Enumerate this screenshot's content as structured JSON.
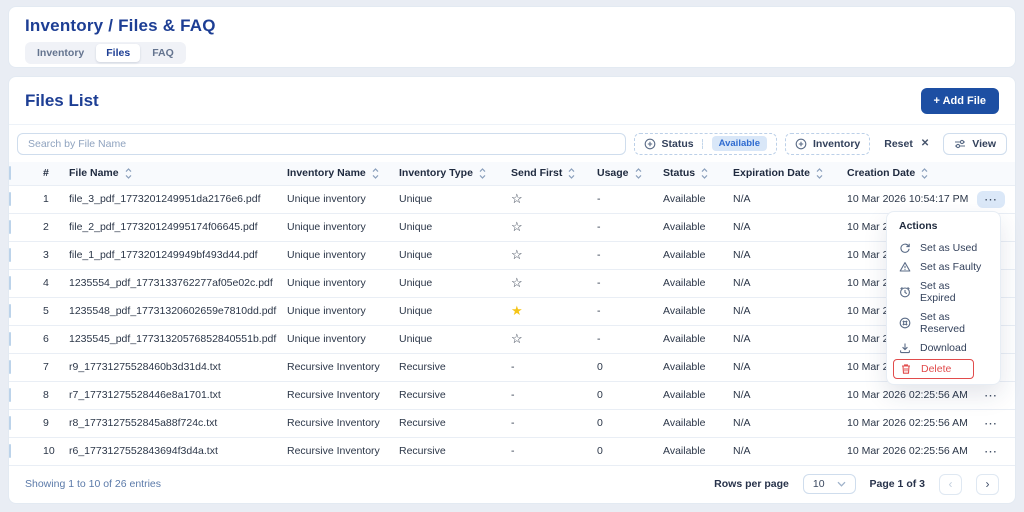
{
  "header": {
    "title": "Inventory / Files & FAQ",
    "tabs": [
      {
        "label": "Inventory",
        "active": false
      },
      {
        "label": "Files",
        "active": true
      },
      {
        "label": "FAQ",
        "active": false
      }
    ]
  },
  "files_panel": {
    "title": "Files List",
    "add_file_label": "+ Add File",
    "search_placeholder": "Search by File Name",
    "filters": {
      "status_label": "Status",
      "status_value": "Available",
      "status_icon": "plus-circle-icon",
      "inventory_label": "Inventory",
      "inventory_icon": "plus-circle-icon",
      "reset_label": "Reset",
      "reset_icon": "close-icon",
      "view_label": "View",
      "view_icon": "sliders-icon"
    },
    "table": {
      "columns": [
        {
          "label": "#",
          "sortable": false
        },
        {
          "label": "File Name",
          "sortable": true
        },
        {
          "label": "Inventory Name",
          "sortable": true
        },
        {
          "label": "Inventory Type",
          "sortable": true
        },
        {
          "label": "Send First",
          "sortable": true
        },
        {
          "label": "Usage",
          "sortable": true
        },
        {
          "label": "Status",
          "sortable": true
        },
        {
          "label": "Expiration Date",
          "sortable": true
        },
        {
          "label": "Creation Date",
          "sortable": true
        }
      ],
      "rows": [
        {
          "num": "1",
          "file_name": "file_3_pdf_1773201249951da2176e6.pdf",
          "inventory_name": "Unique inventory",
          "inventory_type": "Unique",
          "send_first": "star-outline",
          "usage": "-",
          "status": "Available",
          "expiration": "N/A",
          "created": "10 Mar 2026 10:54:17 PM",
          "actions_open": true
        },
        {
          "num": "2",
          "file_name": "file_2_pdf_177320124995174f06645.pdf",
          "inventory_name": "Unique inventory",
          "inventory_type": "Unique",
          "send_first": "star-outline",
          "usage": "-",
          "status": "Available",
          "expiration": "N/A",
          "created": "10 Mar 202",
          "actions_open": false
        },
        {
          "num": "3",
          "file_name": "file_1_pdf_1773201249949bf493d44.pdf",
          "inventory_name": "Unique inventory",
          "inventory_type": "Unique",
          "send_first": "star-outline",
          "usage": "-",
          "status": "Available",
          "expiration": "N/A",
          "created": "10 Mar 202",
          "actions_open": false
        },
        {
          "num": "4",
          "file_name": "1235554_pdf_1773133762277af05e02c.pdf",
          "inventory_name": "Unique inventory",
          "inventory_type": "Unique",
          "send_first": "star-outline",
          "usage": "-",
          "status": "Available",
          "expiration": "N/A",
          "created": "10 Mar 202",
          "actions_open": false
        },
        {
          "num": "5",
          "file_name": "1235548_pdf_17731320602659e7810dd.pdf",
          "inventory_name": "Unique inventory",
          "inventory_type": "Unique",
          "send_first": "star-filled",
          "usage": "-",
          "status": "Available",
          "expiration": "N/A",
          "created": "10 Mar 202",
          "actions_open": false
        },
        {
          "num": "6",
          "file_name": "1235545_pdf_17731320576852840551b.pdf",
          "inventory_name": "Unique inventory",
          "inventory_type": "Unique",
          "send_first": "star-outline",
          "usage": "-",
          "status": "Available",
          "expiration": "N/A",
          "created": "10 Mar 202",
          "actions_open": false
        },
        {
          "num": "7",
          "file_name": "r9_17731275528460b3d31d4.txt",
          "inventory_name": "Recursive Inventory",
          "inventory_type": "Recursive",
          "send_first": "-",
          "usage": "0",
          "status": "Available",
          "expiration": "N/A",
          "created": "10 Mar 2026 02:25:56 AM",
          "actions_open": false
        },
        {
          "num": "8",
          "file_name": "r7_17731275528446e8a1701.txt",
          "inventory_name": "Recursive Inventory",
          "inventory_type": "Recursive",
          "send_first": "-",
          "usage": "0",
          "status": "Available",
          "expiration": "N/A",
          "created": "10 Mar 2026 02:25:56 AM",
          "actions_open": false
        },
        {
          "num": "9",
          "file_name": "r8_1773127552845a88f724c.txt",
          "inventory_name": "Recursive Inventory",
          "inventory_type": "Recursive",
          "send_first": "-",
          "usage": "0",
          "status": "Available",
          "expiration": "N/A",
          "created": "10 Mar 2026 02:25:56 AM",
          "actions_open": false
        },
        {
          "num": "10",
          "file_name": "r6_1773127552843694f3d4a.txt",
          "inventory_name": "Recursive Inventory",
          "inventory_type": "Recursive",
          "send_first": "-",
          "usage": "0",
          "status": "Available",
          "expiration": "N/A",
          "created": "10 Mar 2026 02:25:56 AM",
          "actions_open": false
        }
      ]
    },
    "footer": {
      "showing_text": "Showing 1 to 10 of 26 entries",
      "rows_per_page_label": "Rows per page",
      "rows_per_page_value": "10",
      "page_text": "Page 1 of 3",
      "prev_label": "‹",
      "next_label": "›"
    }
  },
  "actions_menu": {
    "title": "Actions",
    "items": [
      {
        "label": "Set as Used",
        "icon": "refresh-icon",
        "danger": false
      },
      {
        "label": "Set as Faulty",
        "icon": "warning-icon",
        "danger": false
      },
      {
        "label": "Set as Expired",
        "icon": "clock-icon",
        "danger": false
      },
      {
        "label": "Set as Reserved",
        "icon": "reserved-icon",
        "danger": false
      },
      {
        "label": "Download",
        "icon": "download-icon",
        "danger": false
      },
      {
        "label": "Delete",
        "icon": "trash-icon",
        "danger": true
      }
    ]
  },
  "colors": {
    "accent_blue": "#1d3e94",
    "button_blue": "#1d4fa3",
    "badge_bg": "#d9e7f8",
    "badge_text": "#2f6bd0",
    "danger_red": "#e14b4b",
    "star_yellow": "#f5c518",
    "page_bg": "#e9edf4"
  }
}
